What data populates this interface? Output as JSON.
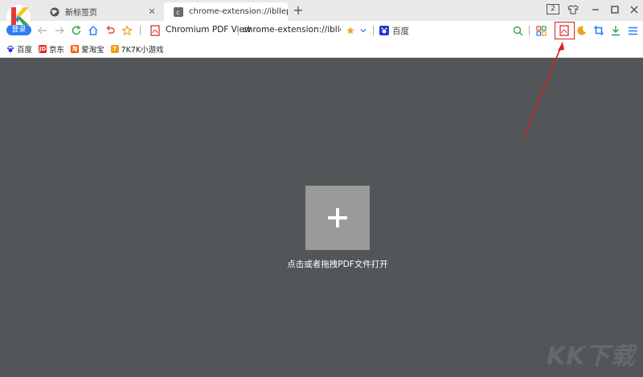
{
  "header": {
    "login_label": "登录",
    "tabs": [
      {
        "title": "新标签页",
        "active": false
      },
      {
        "title": "chrome-extension://ibllepbpa",
        "active": true
      }
    ],
    "tab_count": "2"
  },
  "toolbar": {
    "page_title": "Chromium PDF View",
    "url": "chrome-extension://ibllep...",
    "search_engine": "百度"
  },
  "bookmarks": [
    {
      "label": "百度",
      "icon": "baidu-paw-icon",
      "color": "#2932e1"
    },
    {
      "label": "京东",
      "icon": "jd-icon",
      "color": "#e1251b"
    },
    {
      "label": "爱淘宝",
      "icon": "taobao-icon",
      "color": "#ff5000"
    },
    {
      "label": "7K7K小游戏",
      "icon": "7k7k-icon",
      "color": "#f39c12"
    }
  ],
  "viewer": {
    "open_label": "点击或者拖拽PDF文件打开"
  },
  "watermark": "KK下载",
  "colors": {
    "accent_blue": "#2d7cf6",
    "highlight_red": "#d32020",
    "viewer_bg": "#525659",
    "open_box": "#9a9a9a"
  }
}
